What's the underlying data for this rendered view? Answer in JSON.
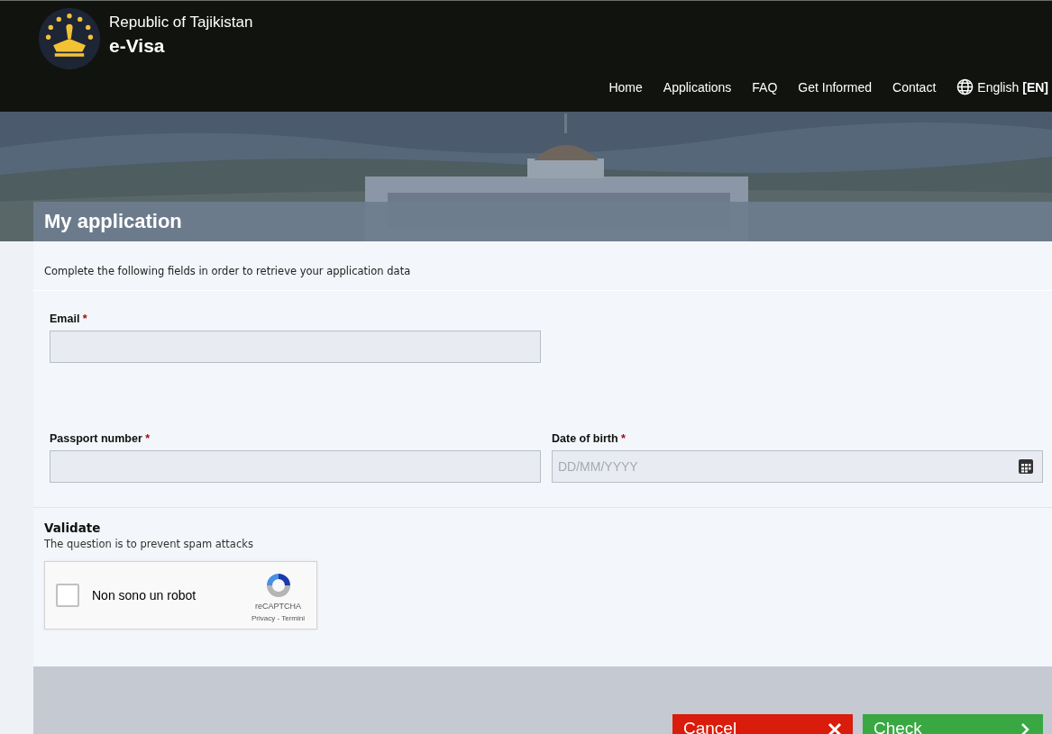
{
  "header": {
    "country": "Republic of Tajikistan",
    "product": "e-Visa"
  },
  "nav": [
    {
      "label": "Home"
    },
    {
      "label": "Applications"
    },
    {
      "label": "FAQ"
    },
    {
      "label": "Get Informed"
    },
    {
      "label": "Contact"
    }
  ],
  "language": {
    "name": "English",
    "code": "[EN]"
  },
  "page_title": "My application",
  "intro": "Complete the following fields in order to retrieve your application data",
  "fields": [
    {
      "label": "Email",
      "required_mark": "*",
      "kind": "text"
    },
    {
      "label": "Passport number",
      "required_mark": "*",
      "kind": "text"
    },
    {
      "label": "Date of birth",
      "required_mark": "*",
      "kind": "date",
      "placeholder": "DD/MM/YYYY"
    }
  ],
  "validate": {
    "title": "Validate",
    "hint": "The question is to prevent spam attacks"
  },
  "captcha": {
    "label": "Non sono un robot",
    "checked": false,
    "brand": "reCAPTCHA",
    "links": "Privacy - Termini"
  },
  "buttons": [
    {
      "label": "Cancel",
      "kind": "cancel"
    },
    {
      "label": "Check",
      "kind": "submit"
    }
  ]
}
